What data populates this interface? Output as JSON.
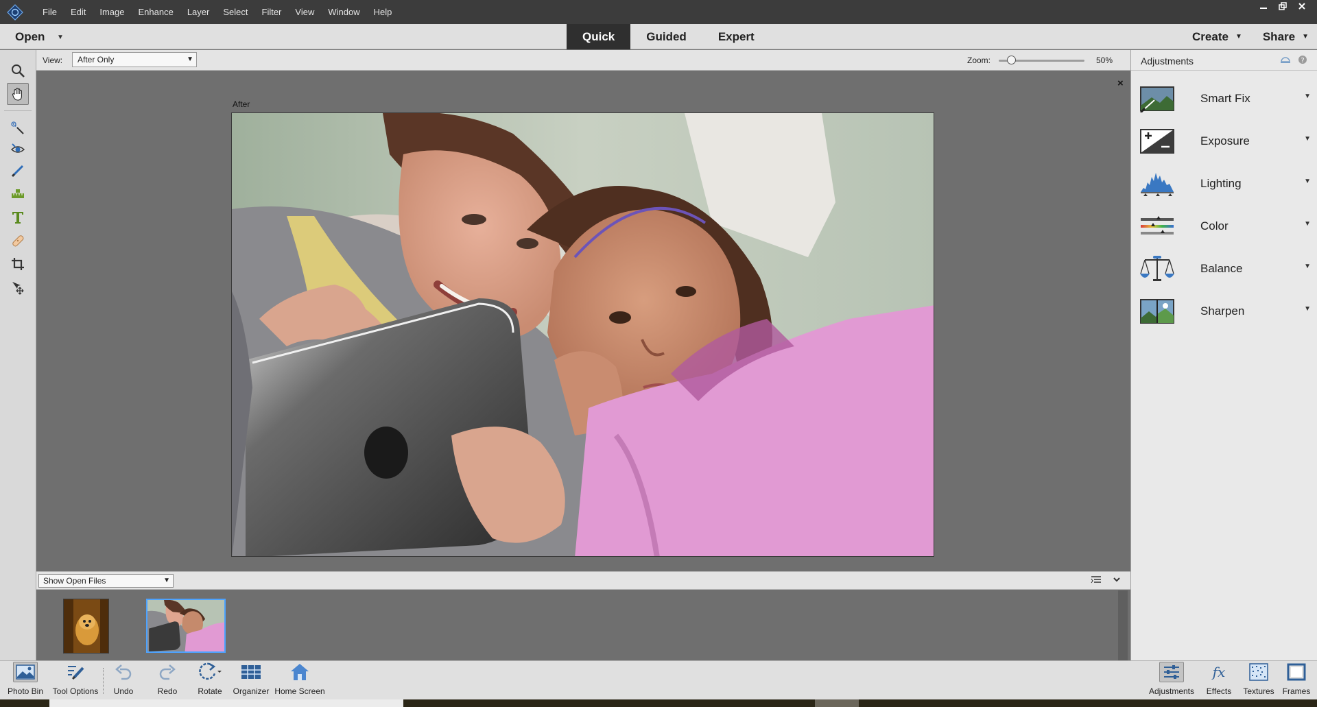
{
  "menubar": {
    "items": [
      "File",
      "Edit",
      "Image",
      "Enhance",
      "Layer",
      "Select",
      "Filter",
      "View",
      "Window",
      "Help"
    ]
  },
  "modebar": {
    "open_label": "Open",
    "tabs": [
      {
        "label": "Quick",
        "active": true
      },
      {
        "label": "Guided",
        "active": false
      },
      {
        "label": "Expert",
        "active": false
      }
    ],
    "create_label": "Create",
    "share_label": "Share"
  },
  "options": {
    "view_label": "View:",
    "view_value": "After Only",
    "zoom_label": "Zoom:",
    "zoom_value": "50%",
    "zoom_fraction": 0.15
  },
  "canvas": {
    "after_label": "After",
    "close_symbol": "×"
  },
  "bin": {
    "show_label": "Show Open Files"
  },
  "panel": {
    "title": "Adjustments",
    "items": [
      {
        "label": "Smart Fix",
        "icon": "smart-fix-icon"
      },
      {
        "label": "Exposure",
        "icon": "exposure-icon"
      },
      {
        "label": "Lighting",
        "icon": "lighting-icon"
      },
      {
        "label": "Color",
        "icon": "color-icon"
      },
      {
        "label": "Balance",
        "icon": "balance-icon"
      },
      {
        "label": "Sharpen",
        "icon": "sharpen-icon"
      }
    ]
  },
  "bottombar": {
    "photo_bin": "Photo Bin",
    "tool_options": "Tool Options",
    "undo": "Undo",
    "redo": "Redo",
    "rotate": "Rotate",
    "organizer": "Organizer",
    "home_screen": "Home Screen",
    "adjustments": "Adjustments",
    "effects": "Effects",
    "textures": "Textures",
    "frames": "Frames"
  },
  "colors": {
    "accent_blue": "#4da3ff",
    "active_tab": "#2f2f2f",
    "canvas_bg": "#6f6f6f"
  }
}
